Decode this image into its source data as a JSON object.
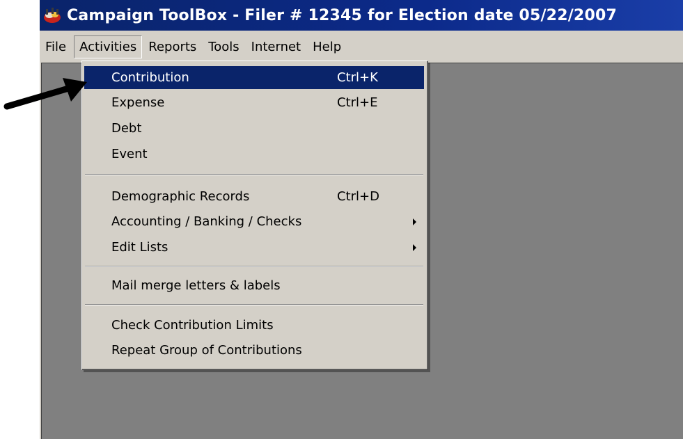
{
  "window": {
    "title": "Campaign ToolBox - Filer # 12345 for Election date 05/22/2007",
    "icon": "campaign-toolbox-icon"
  },
  "menubar": {
    "items": [
      {
        "label": "File"
      },
      {
        "label": "Activities",
        "active": true
      },
      {
        "label": "Reports"
      },
      {
        "label": "Tools"
      },
      {
        "label": "Internet"
      },
      {
        "label": "Help"
      }
    ]
  },
  "activities_menu": {
    "items": [
      {
        "label": "Contribution",
        "shortcut": "Ctrl+K",
        "highlighted": true
      },
      {
        "label": "Expense",
        "shortcut": "Ctrl+E"
      },
      {
        "label": "Debt",
        "shortcut": ""
      },
      {
        "label": "Event",
        "shortcut": ""
      },
      {
        "label": "Demographic Records",
        "shortcut": "Ctrl+D"
      },
      {
        "label": "Accounting / Banking / Checks",
        "shortcut": "",
        "submenu": true
      },
      {
        "label": "Edit Lists",
        "shortcut": "",
        "submenu": true
      },
      {
        "label": "Mail merge letters & labels",
        "shortcut": ""
      },
      {
        "label": "Check Contribution Limits",
        "shortcut": ""
      },
      {
        "label": "Repeat Group of Contributions",
        "shortcut": ""
      }
    ]
  },
  "colors": {
    "titlebar": "#0a246a",
    "highlight": "#0a246a",
    "face": "#d4d0c8",
    "client": "#808080"
  },
  "annotation": {
    "icon": "pointer-arrow-icon"
  }
}
